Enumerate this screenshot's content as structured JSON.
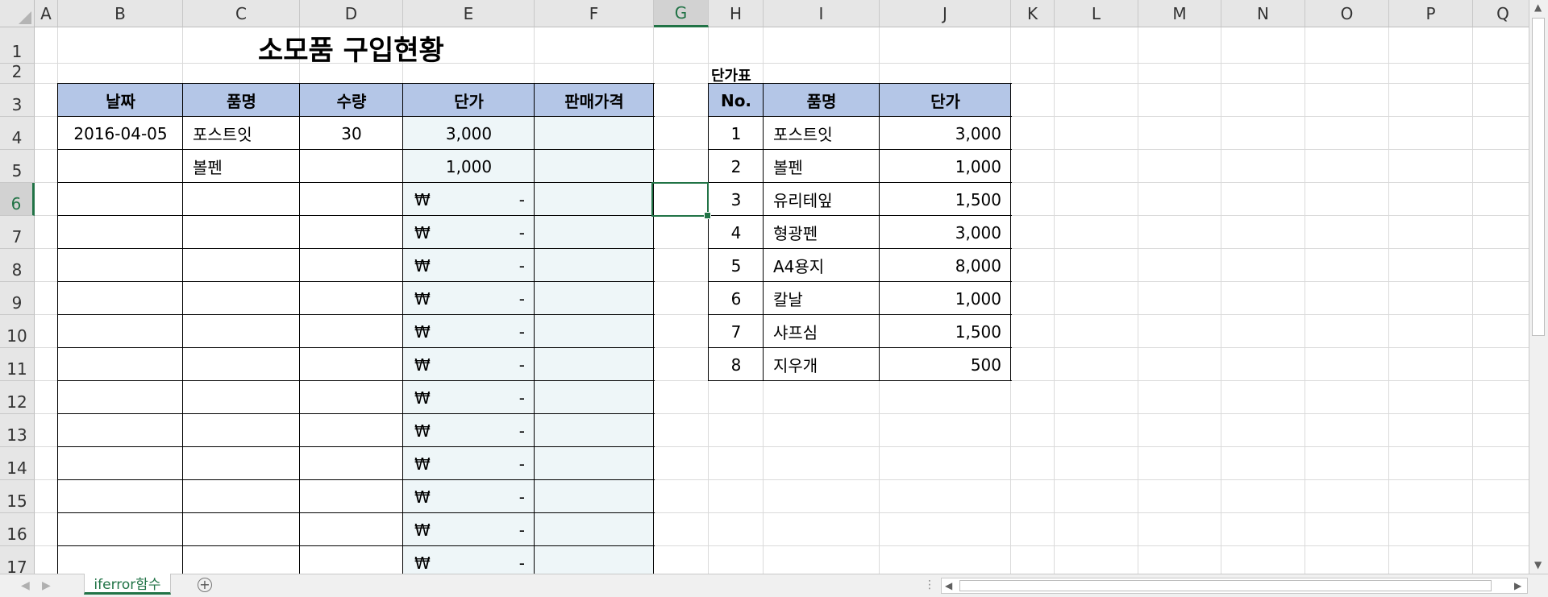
{
  "columns": [
    "A",
    "B",
    "C",
    "D",
    "E",
    "F",
    "G",
    "H",
    "I",
    "J",
    "K",
    "L",
    "M",
    "N",
    "O",
    "P",
    "Q"
  ],
  "rows": [
    "1",
    "2",
    "3",
    "4",
    "5",
    "6",
    "7",
    "8",
    "9",
    "10",
    "11",
    "12",
    "13",
    "14",
    "15",
    "16",
    "17"
  ],
  "selected_cell": {
    "col": "G",
    "row": "6"
  },
  "title": "소모품 구입현황",
  "purchase_table": {
    "headers": [
      "날짜",
      "품명",
      "수량",
      "단가",
      "판매가격"
    ],
    "rows": [
      {
        "date": "2016-04-05",
        "item": "포스트잇",
        "qty": "30",
        "price": "3,000",
        "sale": ""
      },
      {
        "date": "",
        "item": "볼펜",
        "qty": "",
        "price": "1,000",
        "sale": ""
      }
    ],
    "empty_price_symbol": "₩",
    "empty_price_value": "-"
  },
  "price_list": {
    "label": "단가표",
    "headers": [
      "No.",
      "품명",
      "단가"
    ],
    "rows": [
      {
        "no": "1",
        "item": "포스트잇",
        "price": "3,000"
      },
      {
        "no": "2",
        "item": "볼펜",
        "price": "1,000"
      },
      {
        "no": "3",
        "item": "유리테잎",
        "price": "1,500"
      },
      {
        "no": "4",
        "item": "형광펜",
        "price": "3,000"
      },
      {
        "no": "5",
        "item": "A4용지",
        "price": "8,000"
      },
      {
        "no": "6",
        "item": "칼날",
        "price": "1,000"
      },
      {
        "no": "7",
        "item": "샤프심",
        "price": "1,500"
      },
      {
        "no": "8",
        "item": "지우개",
        "price": "500"
      }
    ]
  },
  "sheet_tabs": [
    "iferror함수"
  ],
  "add_sheet_label": "+",
  "colors": {
    "accent": "#217346",
    "header_fill": "#b4c6e7",
    "price_fill": "#eef6f8"
  }
}
